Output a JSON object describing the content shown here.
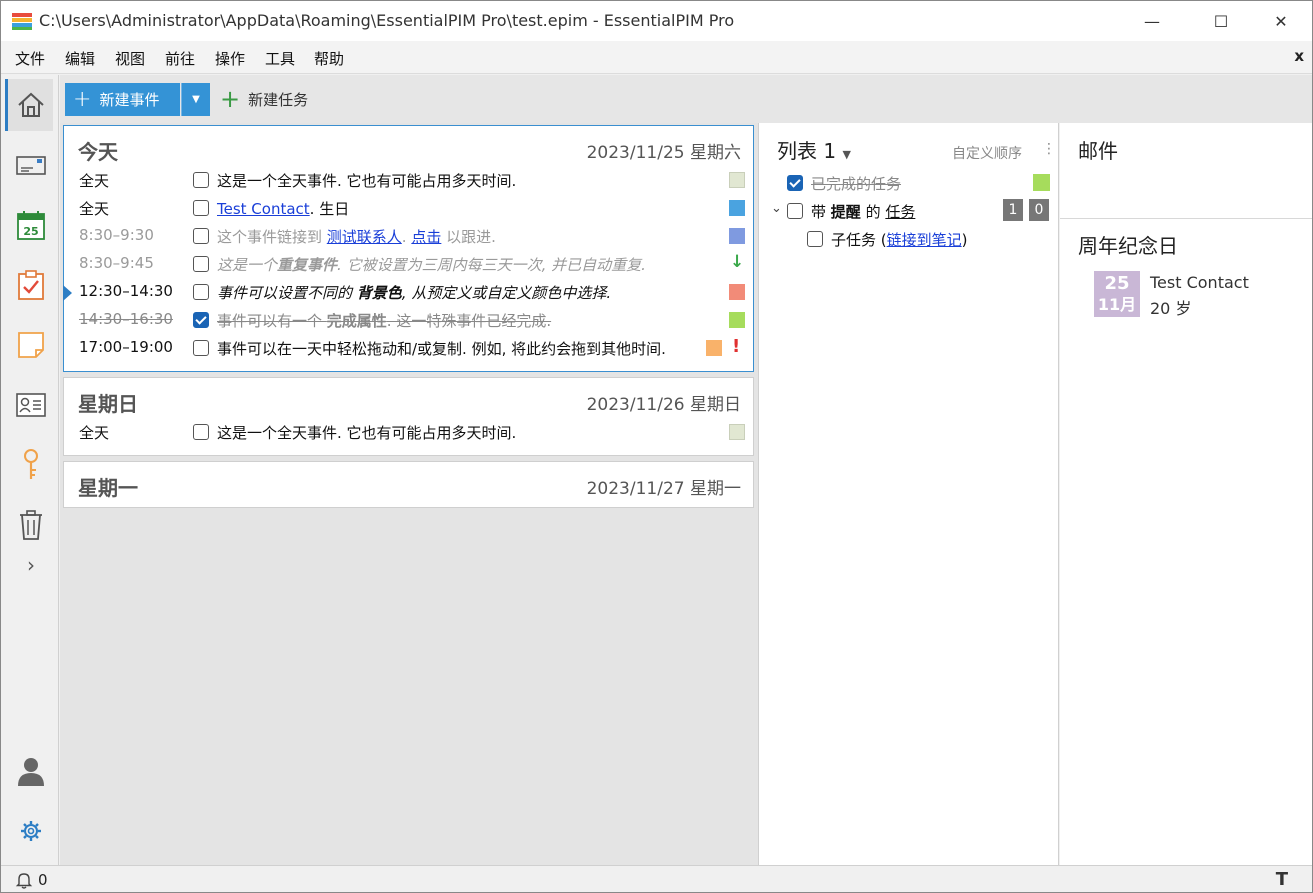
{
  "window": {
    "title": "C:\\Users\\Administrator\\AppData\\Roaming\\EssentialPIM Pro\\test.epim - EssentialPIM Pro",
    "minimize": "—",
    "maximize": "☐",
    "close": "✕"
  },
  "menu": {
    "items": [
      "文件",
      "编辑",
      "视图",
      "前往",
      "操作",
      "工具",
      "帮助"
    ],
    "close": "x"
  },
  "nav": {
    "items": [
      "home-icon",
      "mail-icon",
      "calendar-icon",
      "tasks-icon",
      "notes-icon",
      "contacts-icon",
      "passwords-icon",
      "trash-icon"
    ],
    "expand": "›",
    "calendar_day": "25"
  },
  "toolbar": {
    "new_event": "新建事件",
    "new_task": "新建任务"
  },
  "days": [
    {
      "title": "今天",
      "date": "2023/11/25 星期六",
      "events": [
        {
          "time": "全天",
          "text": "这是一个全天事件. 它也有可能占用多天时间.",
          "color": "#e1e7d2"
        },
        {
          "time": "全天",
          "link": "Test Contact",
          "text_after": ". 生日",
          "color": "#4aa3e0"
        },
        {
          "time": "8:30–9:30",
          "text_before": "这个事件链接到 ",
          "link1": "测试联系人",
          "sep": ". ",
          "link2": "点击",
          "text_after": " 以跟进.",
          "color": "#7f9ae0"
        },
        {
          "time": "8:30–9:45",
          "text_before": "这是一个",
          "bold": "重复事件",
          "text_after": ". 它被设置为三周内每三天一次, 并已自动重复.",
          "indicator": "↓"
        },
        {
          "time": "12:30–14:30",
          "text_before": "事件可以设置不同的 ",
          "bold": "背景色",
          "text_after": ", 从预定义或自定义颜色中选择.",
          "color": "#f28b78"
        },
        {
          "time": "14:30–16:30",
          "text_before": "事件可以有一个 ",
          "bold": "完成属性",
          "text_after": ". 这一特殊事件已经完成.",
          "color": "#a6dc5c"
        },
        {
          "time": "17:00–19:00",
          "text": "事件可以在一天中轻松拖动和/或复制. 例如, 将此约会拖到其他时间.",
          "color": "#f9b26a",
          "priority": "!"
        }
      ]
    },
    {
      "title": "星期日",
      "date": "2023/11/26 星期日",
      "events": [
        {
          "time": "全天",
          "text": "这是一个全天事件. 它也有可能占用多天时间.",
          "color": "#e1e7d2"
        }
      ]
    },
    {
      "title": "星期一",
      "date": "2023/11/27 星期一",
      "events": []
    }
  ],
  "tasks": {
    "list_title": "列表 1",
    "order": "自定义顺序",
    "items": [
      {
        "label": "已完成的任务",
        "done": true,
        "color": "#a6dc5c"
      },
      {
        "label_prefix": "带 ",
        "label_bold": "提醒",
        "label_mid": " 的 ",
        "label_underline": "任务",
        "done": false,
        "badges": [
          "1",
          "0"
        ]
      },
      {
        "label_prefix": "子任务 (",
        "link": "链接到笔记",
        "label_suffix": ")",
        "done": false
      }
    ]
  },
  "right": {
    "mail_title": "邮件",
    "anniversary_title": "周年纪念日",
    "anniversary": {
      "day": "25",
      "month": "11月",
      "name": "Test Contact",
      "age": "20 岁"
    }
  },
  "status": {
    "reminders": "0"
  }
}
